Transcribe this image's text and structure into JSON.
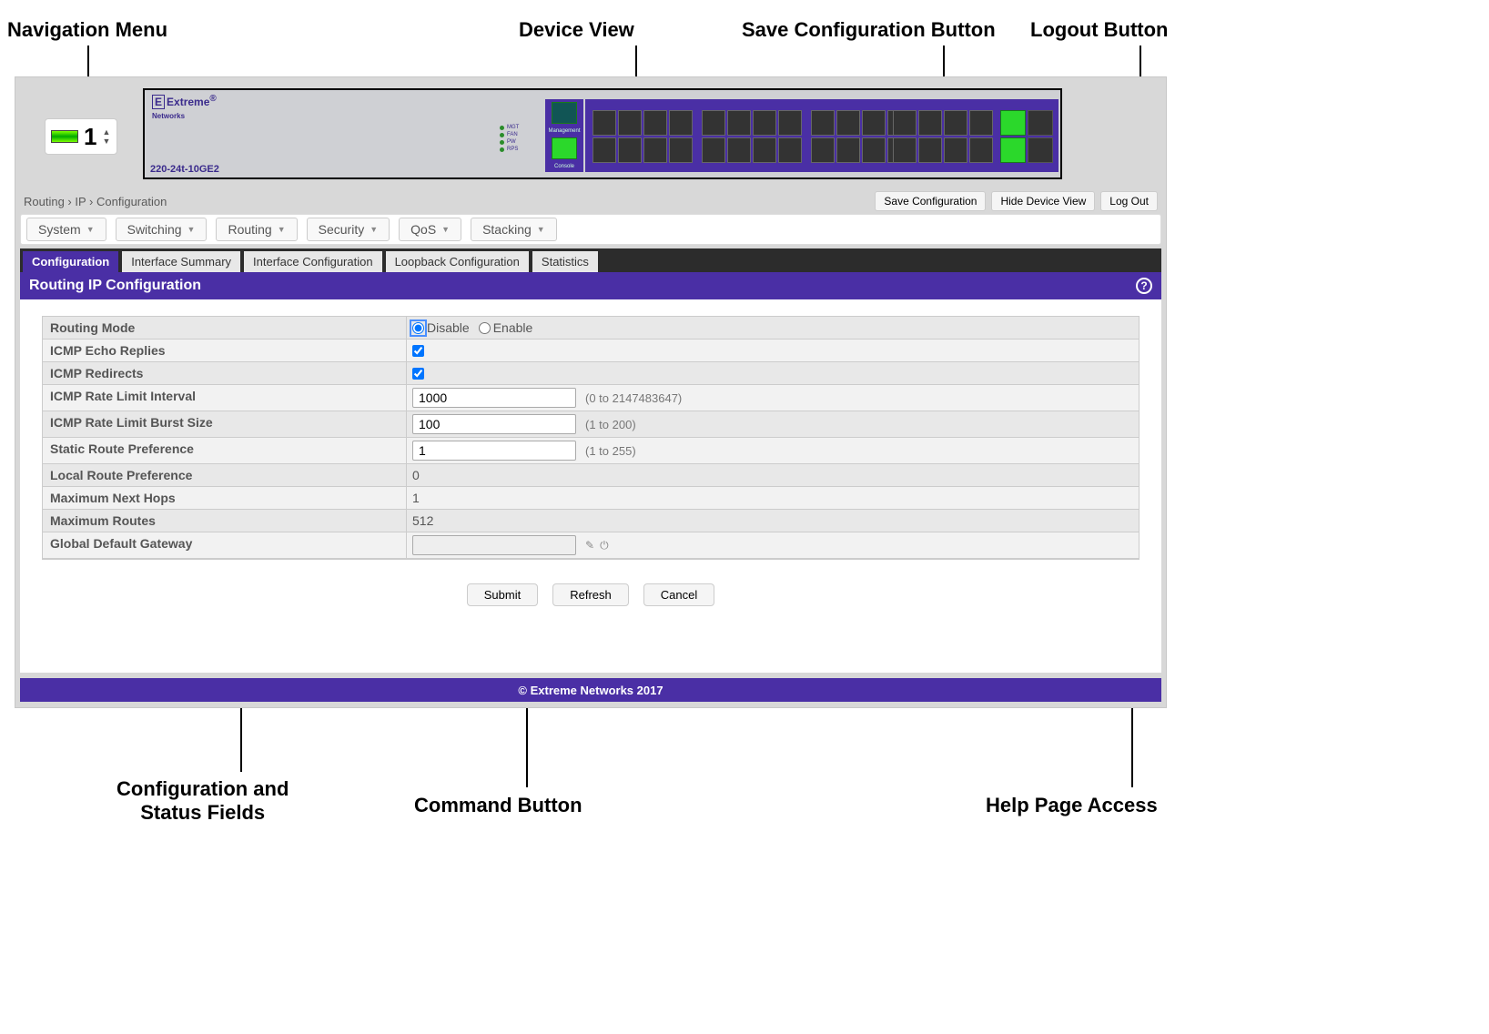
{
  "callouts": {
    "nav_menu": "Navigation Menu",
    "device_view": "Device View",
    "save_config": "Save Configuration Button",
    "logout": "Logout Button",
    "config_fields": "Configuration and\nStatus Fields",
    "command_button": "Command Button",
    "help_access": "Help Page Access"
  },
  "device": {
    "brand": "Extreme",
    "brand_sub": "Networks",
    "model": "220-24t-10GE2",
    "leds": [
      "MGT",
      "FAN",
      "PW",
      "RPS"
    ],
    "mgmt": {
      "top_label": "Management",
      "bottom_label": "Console"
    }
  },
  "unit": {
    "number": "1"
  },
  "breadcrumb": {
    "level1": "Routing",
    "level2": "IP",
    "level3": "Configuration"
  },
  "top_buttons": {
    "save": "Save Configuration",
    "hide": "Hide Device View",
    "logout": "Log Out"
  },
  "nav": {
    "items": [
      "System",
      "Switching",
      "Routing",
      "Security",
      "QoS",
      "Stacking"
    ]
  },
  "tabs": {
    "items": [
      {
        "label": "Configuration",
        "active": true
      },
      {
        "label": "Interface Summary",
        "active": false
      },
      {
        "label": "Interface Configuration",
        "active": false
      },
      {
        "label": "Loopback Configuration",
        "active": false
      },
      {
        "label": "Statistics",
        "active": false
      }
    ]
  },
  "page_title": "Routing IP Configuration",
  "form": {
    "routing_mode": {
      "label": "Routing Mode",
      "disable": "Disable",
      "enable": "Enable",
      "selected": "Disable"
    },
    "icmp_echo": {
      "label": "ICMP Echo Replies",
      "checked": true
    },
    "icmp_redirects": {
      "label": "ICMP Redirects",
      "checked": true
    },
    "rate_interval": {
      "label": "ICMP Rate Limit Interval",
      "value": "1000",
      "hint": "(0 to 2147483647)"
    },
    "rate_burst": {
      "label": "ICMP Rate Limit Burst Size",
      "value": "100",
      "hint": "(1 to 200)"
    },
    "static_pref": {
      "label": "Static Route Preference",
      "value": "1",
      "hint": "(1 to 255)"
    },
    "local_pref": {
      "label": "Local Route Preference",
      "value": "0"
    },
    "max_hops": {
      "label": "Maximum Next Hops",
      "value": "1"
    },
    "max_routes": {
      "label": "Maximum Routes",
      "value": "512"
    },
    "gateway": {
      "label": "Global Default Gateway",
      "value": ""
    }
  },
  "actions": {
    "submit": "Submit",
    "refresh": "Refresh",
    "cancel": "Cancel"
  },
  "footer": "© Extreme Networks 2017",
  "icons": {
    "edit": "✎",
    "power": "⏻",
    "help": "?"
  }
}
